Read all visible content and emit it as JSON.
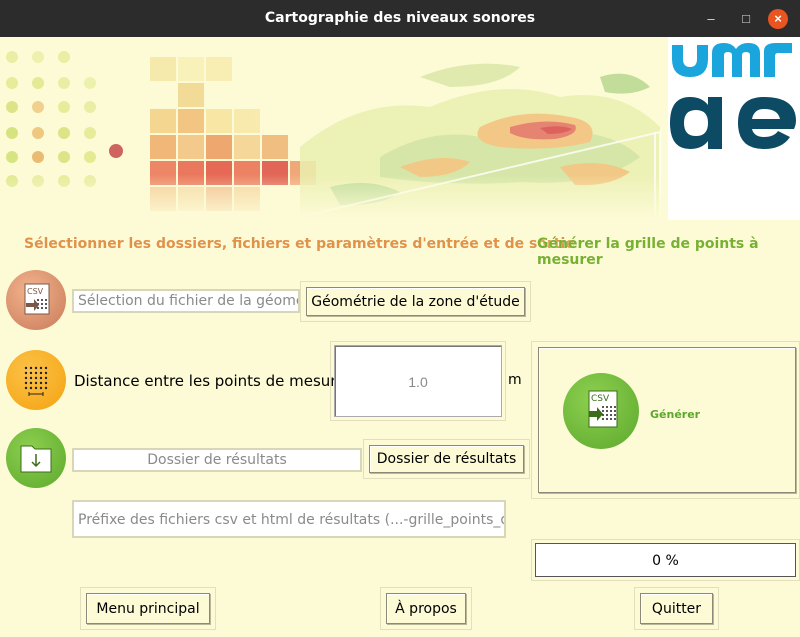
{
  "window": {
    "title": "Cartographie des niveaux sonores"
  },
  "sections": {
    "left_title": "Sélectionner les dossiers, fichiers et paramètres d'entrée et de sortie",
    "right_title": "Générer la grille de points à mesurer"
  },
  "geometry": {
    "field_placeholder": "Sélection du fichier de la géométrie",
    "button_label": "Géométrie de la zone d'étude",
    "icon_text": "CSV"
  },
  "distance": {
    "label": "Distance entre les points de mesure",
    "value": "1.0",
    "unit": "m"
  },
  "results": {
    "field_placeholder": "Dossier de résultats",
    "button_label": "Dossier de résultats"
  },
  "prefix": {
    "field_placeholder": "Préfixe des fichiers csv et html de résultats (...-grille_points_de_mesure)"
  },
  "generate": {
    "label": "Générer",
    "icon_text": "CSV"
  },
  "progress": {
    "text": "0 %",
    "value": 0
  },
  "footer": {
    "menu_label": "Menu principal",
    "about_label": "À propos",
    "quit_label": "Quitter"
  },
  "colors": {
    "background": "#fdfbd6",
    "orange_title": "#e09246",
    "green_title": "#78b12f",
    "logo_blue": "#1aa6dc",
    "logo_dark": "#0d4a63"
  }
}
